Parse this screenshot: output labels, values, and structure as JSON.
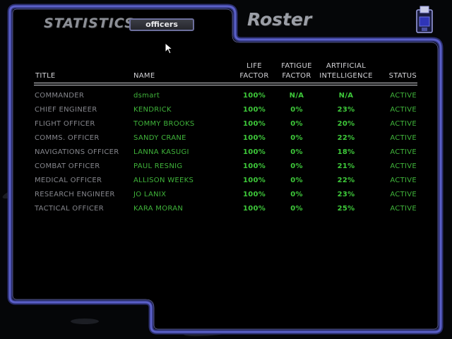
{
  "header": {
    "statistics_label": "STATISTICS:",
    "filter_value": "officers",
    "screen_title": "Roster"
  },
  "table": {
    "columns": {
      "title": "TITLE",
      "name": "NAME",
      "life_1": "LIFE",
      "life_2": "FACTOR",
      "fatigue_1": "FATIGUE",
      "fatigue_2": "FACTOR",
      "ai_1": "ARTIFICIAL",
      "ai_2": "INTELLIGENCE",
      "status": "STATUS"
    },
    "rows": [
      {
        "title": "COMMANDER",
        "name": "dsmart",
        "life": "100%",
        "fatigue": "N/A",
        "ai": "N/A",
        "status": "ACTIVE"
      },
      {
        "title": "CHIEF ENGINEER",
        "name": "KENDRICK",
        "life": "100%",
        "fatigue": "0%",
        "ai": "23%",
        "status": "ACTIVE"
      },
      {
        "title": "FLIGHT OFFICER",
        "name": "TOMMY BROOKS",
        "life": "100%",
        "fatigue": "0%",
        "ai": "20%",
        "status": "ACTIVE"
      },
      {
        "title": "COMMS. OFFICER",
        "name": "SANDY CRANE",
        "life": "100%",
        "fatigue": "0%",
        "ai": "22%",
        "status": "ACTIVE"
      },
      {
        "title": "NAVIGATIONS OFFICER",
        "name": "LANNA KASUGI",
        "life": "100%",
        "fatigue": "0%",
        "ai": "18%",
        "status": "ACTIVE"
      },
      {
        "title": "COMBAT OFFICER",
        "name": "PAUL RESNIG",
        "life": "100%",
        "fatigue": "0%",
        "ai": "21%",
        "status": "ACTIVE"
      },
      {
        "title": "MEDICAL OFFICER",
        "name": "ALLISON WEEKS",
        "life": "100%",
        "fatigue": "0%",
        "ai": "22%",
        "status": "ACTIVE"
      },
      {
        "title": "RESEARCH ENGINEER",
        "name": "JO LANIX",
        "life": "100%",
        "fatigue": "0%",
        "ai": "23%",
        "status": "ACTIVE"
      },
      {
        "title": "TACTICAL OFFICER",
        "name": "KARA MORAN",
        "life": "100%",
        "fatigue": "0%",
        "ai": "25%",
        "status": "ACTIVE"
      }
    ]
  },
  "icons": {
    "disk": "floppy-disk-icon",
    "cursor": "mouse-pointer-icon"
  },
  "colors": {
    "frame": "#5a5fc8",
    "value_green": "#3ec93a",
    "label_grey": "#85868c",
    "background": "#050608"
  }
}
